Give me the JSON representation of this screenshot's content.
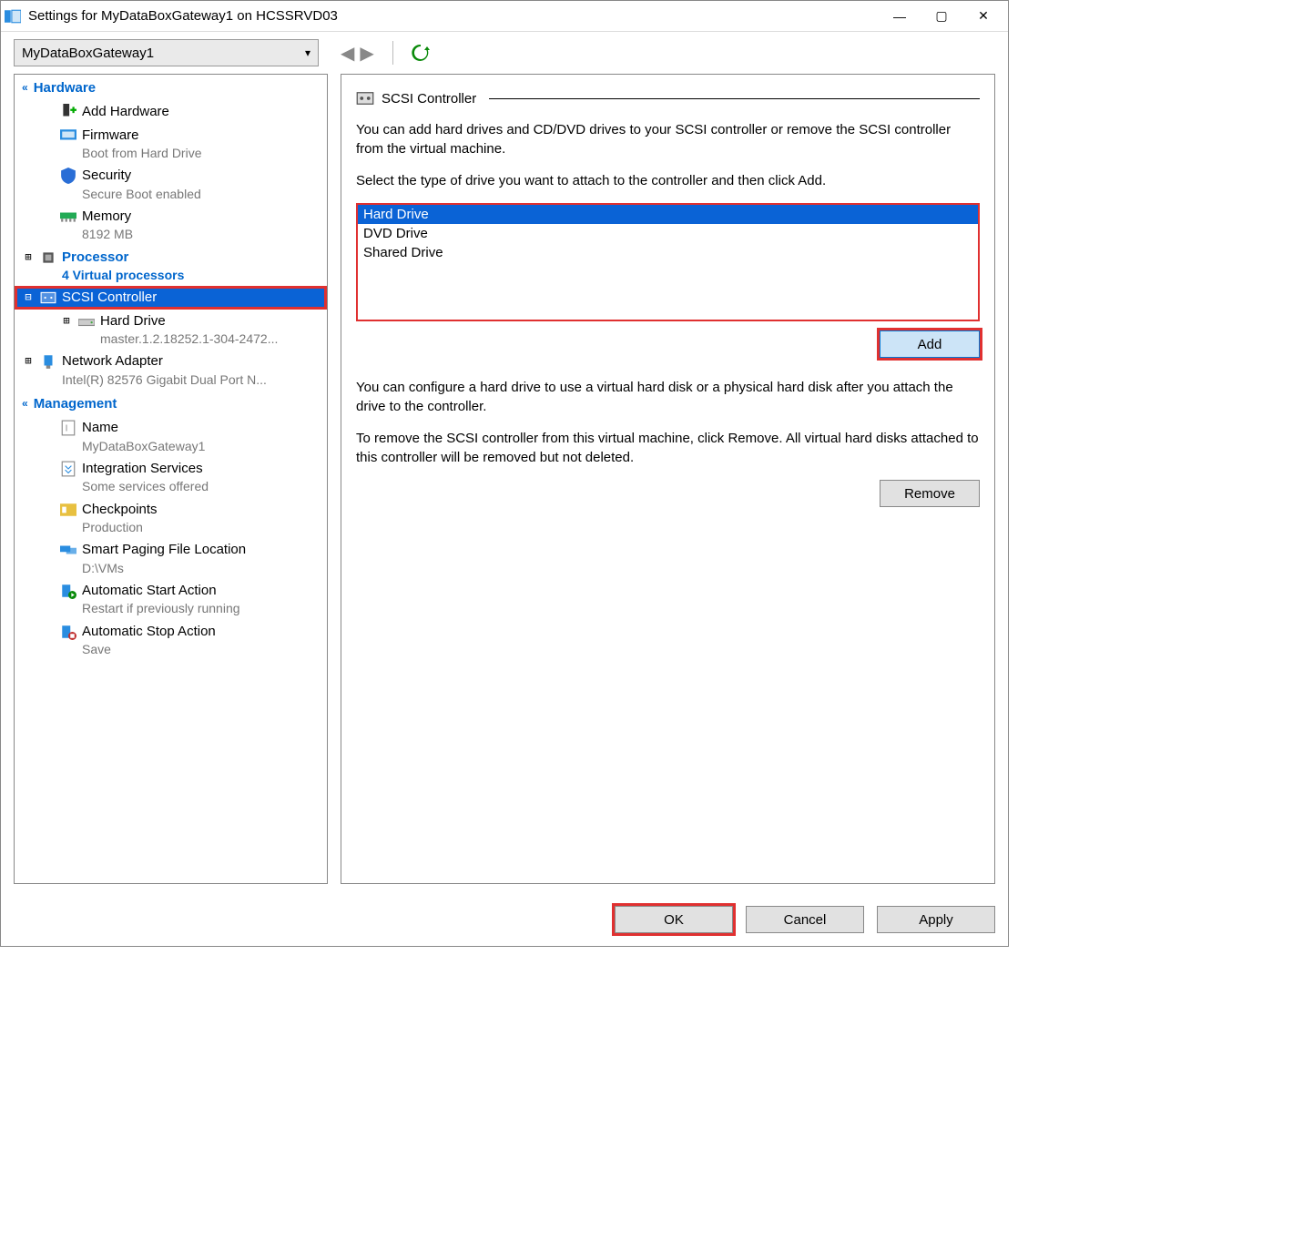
{
  "window": {
    "title": "Settings for MyDataBoxGateway1 on HCSSRVD03"
  },
  "toolbar": {
    "vm_name": "MyDataBoxGateway1"
  },
  "sidebar": {
    "hardware_header": "Hardware",
    "items": [
      {
        "label": "Add Hardware",
        "sub": ""
      },
      {
        "label": "Firmware",
        "sub": "Boot from Hard Drive"
      },
      {
        "label": "Security",
        "sub": "Secure Boot enabled"
      },
      {
        "label": "Memory",
        "sub": "8192 MB"
      },
      {
        "label": "Processor",
        "sub": "4 Virtual processors"
      },
      {
        "label": "SCSI Controller",
        "sub": ""
      },
      {
        "label": "Hard Drive",
        "sub": "master.1.2.18252.1-304-2472..."
      },
      {
        "label": "Network Adapter",
        "sub": "Intel(R) 82576 Gigabit Dual Port N..."
      }
    ],
    "management_header": "Management",
    "mgmt": [
      {
        "label": "Name",
        "sub": "MyDataBoxGateway1"
      },
      {
        "label": "Integration Services",
        "sub": "Some services offered"
      },
      {
        "label": "Checkpoints",
        "sub": "Production"
      },
      {
        "label": "Smart Paging File Location",
        "sub": "D:\\VMs"
      },
      {
        "label": "Automatic Start Action",
        "sub": "Restart if previously running"
      },
      {
        "label": "Automatic Stop Action",
        "sub": "Save"
      }
    ]
  },
  "panel": {
    "title": "SCSI Controller",
    "desc1": "You can add hard drives and CD/DVD drives to your SCSI controller or remove the SCSI controller from the virtual machine.",
    "desc2": "Select the type of drive you want to attach to the controller and then click Add.",
    "options": [
      "Hard Drive",
      "DVD Drive",
      "Shared Drive"
    ],
    "add_label": "Add",
    "desc3": "You can configure a hard drive to use a virtual hard disk or a physical hard disk after you attach the drive to the controller.",
    "desc4": "To remove the SCSI controller from this virtual machine, click Remove. All virtual hard disks attached to this controller will be removed but not deleted.",
    "remove_label": "Remove"
  },
  "footer": {
    "ok": "OK",
    "cancel": "Cancel",
    "apply": "Apply"
  }
}
